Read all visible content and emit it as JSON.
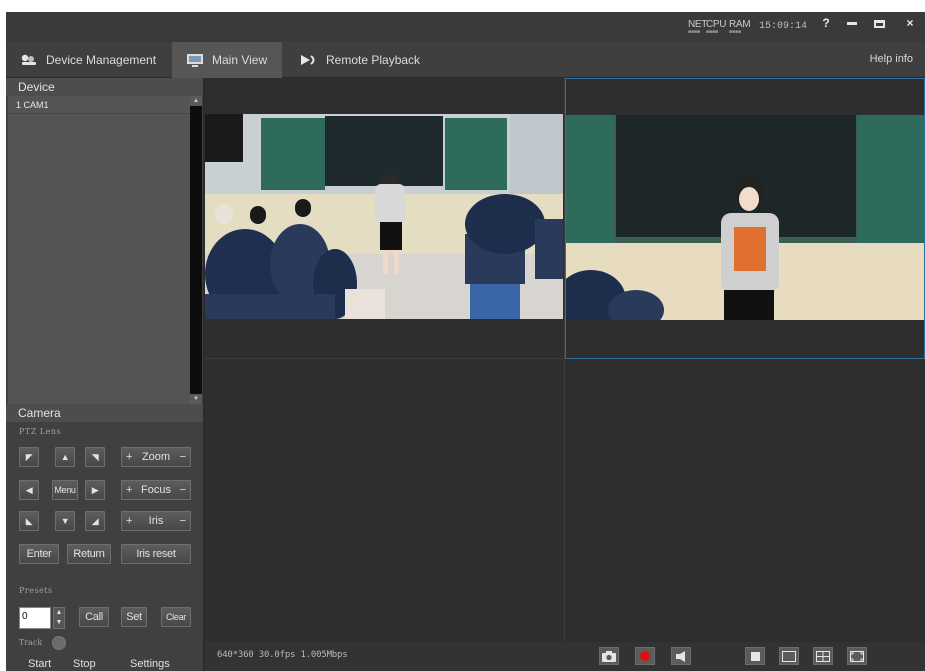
{
  "titlebar": {
    "net_label": "NET",
    "cpu_label": "CPU",
    "ram_label": "RAM",
    "clock": "15:09:14",
    "help_label": "?",
    "close_label": "×"
  },
  "tabs": [
    {
      "label": "Device Management",
      "icon": "devices-icon"
    },
    {
      "label": "Main View",
      "icon": "monitor-icon",
      "active": true
    },
    {
      "label": "Remote Playback",
      "icon": "playback-icon"
    }
  ],
  "help_info": "Help info",
  "device": {
    "header": "Device",
    "items": [
      "1 CAM1"
    ]
  },
  "camera": {
    "header": "Camera",
    "ptz_label": "PTZ Lens",
    "menu_label": "Menu",
    "zoom_label": "Zoom",
    "focus_label": "Focus",
    "iris_label": "Iris",
    "plus": "+",
    "minus": "−",
    "enter_label": "Enter",
    "return_label": "Return",
    "iris_reset_label": "Iris reset",
    "presets_label": "Presets",
    "preset_value": "0",
    "call_label": "Call",
    "set_label": "Set",
    "clear_label": "Clear",
    "track_label": "Track",
    "start_label": "Start",
    "stop_label": "Stop",
    "settings_label": "Settings"
  },
  "status": {
    "stream_info": "640*360 30.0fps 1.005Mbps"
  },
  "colors": {
    "accent": "#2f6f9f",
    "record": "#e01010"
  }
}
